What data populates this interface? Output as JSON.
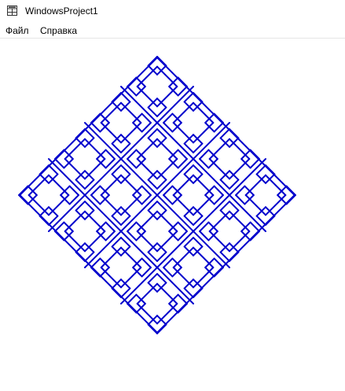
{
  "window": {
    "title": "WindowsProject1",
    "icon": "app-window-icon"
  },
  "menu": {
    "items": [
      {
        "label": "Файл"
      },
      {
        "label": "Справка"
      }
    ]
  },
  "drawing": {
    "type": "square-fractal-curve",
    "stroke_color": "#0000cc"
  }
}
